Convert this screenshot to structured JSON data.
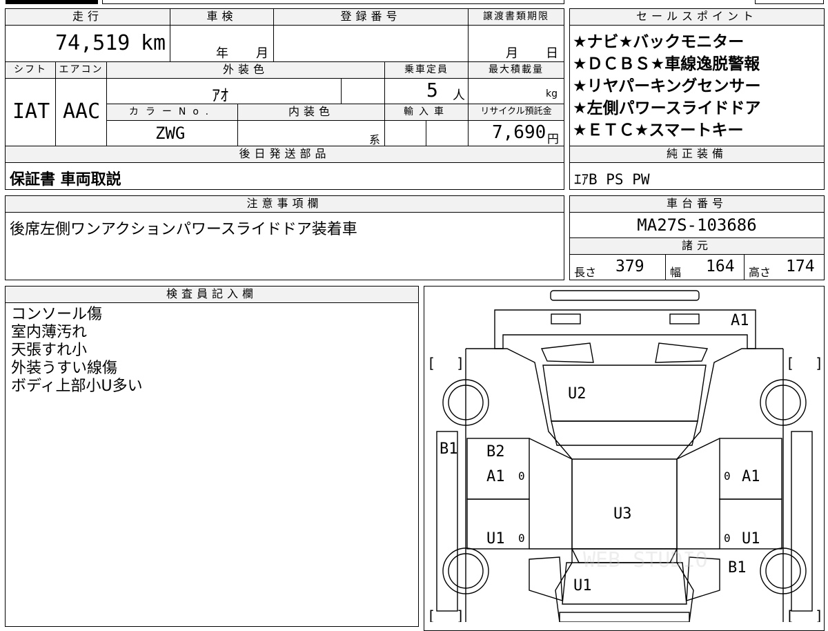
{
  "top": {
    "labels": {
      "mileage": "走行",
      "inspection": "車検",
      "reg_number": "登録番号",
      "transfer_deadline": "譲渡書類期限",
      "shift": "シフト",
      "aircon": "エアコン",
      "exterior_color": "外装色",
      "capacity": "乗車定員",
      "max_load": "最大積載量",
      "color_no": "カラーNo.",
      "interior_color": "内装色",
      "import_car": "輸入車",
      "recycle_fee": "リサイクル預託金"
    },
    "values": {
      "mileage": "74,519",
      "mileage_unit": "km",
      "inspection_year_unit": "年",
      "inspection_month_unit": "月",
      "deadline_month_unit": "月",
      "deadline_day_unit": "日",
      "shift": "IAT",
      "aircon": "AAC",
      "exterior_color": "ｱｵ",
      "capacity": "5",
      "capacity_unit": "人",
      "max_load_unit": "kg",
      "color_no": "ZWG",
      "interior_suffix": "系",
      "recycle_fee": "7,690",
      "recycle_unit": "円"
    }
  },
  "sales": {
    "label": "セールスポイント",
    "items": [
      "★ナビ★バックモニター",
      "★ＤＣＢＳ★車線逸脱警報",
      "★リヤパーキングセンサー",
      "★左側パワースライドドア",
      "★ＥＴＣ★スマートキー"
    ]
  },
  "later_parts": {
    "label": "後日発送部品",
    "value": "保証書 車両取説"
  },
  "genuine": {
    "label": "純正装備",
    "value": "ｴｱB PS PW"
  },
  "notes": {
    "label": "注意事項欄",
    "value": "後席左側ワンアクションパワースライドドア装着車"
  },
  "chassis": {
    "label": "車台番号",
    "value": "MA27S-103686"
  },
  "specs": {
    "label": "諸元",
    "length_label": "長さ",
    "length": "379",
    "width_label": "幅",
    "width": "164",
    "height_label": "高さ",
    "height": "174"
  },
  "inspector": {
    "label": "検査員記入欄",
    "lines": [
      "コンソール傷",
      "室内薄汚れ",
      "天張すれ小",
      "外装うすい線傷",
      "ボディ上部小U多い"
    ]
  },
  "diagram": {
    "marks": {
      "front_bumper": "A1",
      "hood": "U2",
      "left_front_fender": "B1",
      "left_front_door_b2": "B2",
      "left_front_door_a1": "A1",
      "left_rear_door": "U1",
      "right_front_door": "A1",
      "right_rear_door": "U1",
      "right_rear_fender": "B1",
      "roof": "U3",
      "rear_gate": "U1"
    },
    "zero": "0",
    "watermark": "WEB STUDIO"
  }
}
